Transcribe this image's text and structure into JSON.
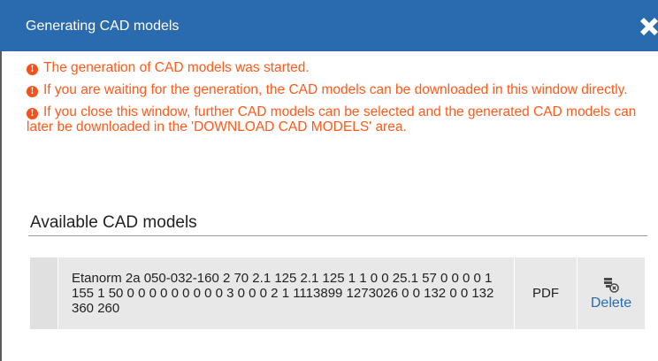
{
  "dialog": {
    "title": "Generating CAD models",
    "close_icon": "close-icon"
  },
  "colors": {
    "title_bar": "#2a6bb0",
    "message_text": "#ff5a1a",
    "link": "#2a6bb0",
    "row_bg": "#e8e8e8"
  },
  "messages": [
    {
      "icon": "info-icon",
      "text": "The generation of CAD models was started."
    },
    {
      "icon": "info-icon",
      "text": "If you are waiting for the generation, the CAD models can be downloaded in this window directly."
    },
    {
      "icon": "info-icon",
      "text": "If you close this window, further CAD models can be selected and the generated CAD models can later be downloaded in the 'DOWNLOAD CAD MODELS' area."
    }
  ],
  "section": {
    "title": "Available CAD models"
  },
  "models": [
    {
      "name": "Etanorm 2a 050-032-160 2 70 2.1 125 2.1 125 1 1 0 0 25.1 57 0 0 0 0 1 155 1 50 0 0 0 0 0 0 0 0 0 3 0 0 0 2 1 1113899 1273026 0 0 132 0 0 132 360 260",
      "format": "PDF",
      "delete_label": "Delete",
      "delete_icon": "delete-model-icon"
    }
  ]
}
